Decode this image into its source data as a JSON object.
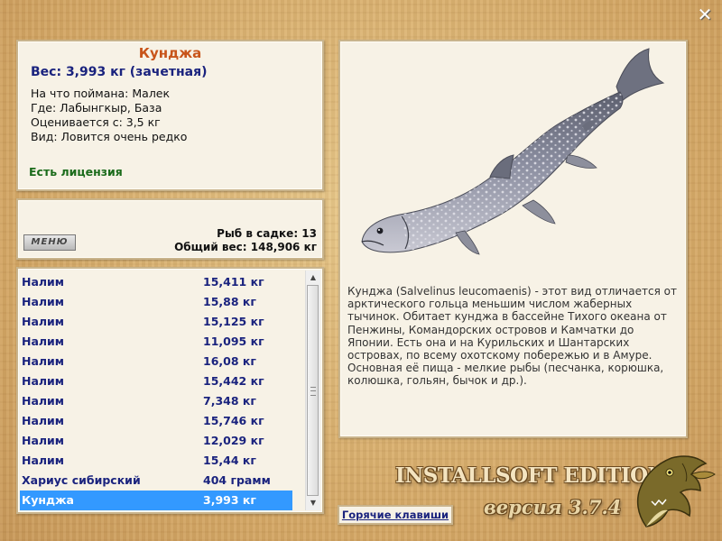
{
  "fish": {
    "title": "Кунджа",
    "weight": "Вес: 3,993 кг (зачетная)",
    "bait": "На что поймана: Малек",
    "location": "Где: Лабынгкыр, База",
    "valued": "Оценивается с: 3,5 кг",
    "type": "Вид: Ловится очень редко",
    "license": "Есть лицензия"
  },
  "cage": {
    "menu_label": "МЕНЮ",
    "count": "Рыб в садке: 13",
    "total_weight": "Общий вес: 148,906 кг"
  },
  "list": {
    "items": [
      {
        "name": "Налим",
        "weight": "15,411 кг"
      },
      {
        "name": "Налим",
        "weight": "15,88 кг"
      },
      {
        "name": "Налим",
        "weight": "15,125 кг"
      },
      {
        "name": "Налим",
        "weight": "11,095 кг"
      },
      {
        "name": "Налим",
        "weight": "16,08 кг"
      },
      {
        "name": "Налим",
        "weight": "15,442 кг"
      },
      {
        "name": "Налим",
        "weight": "7,348 кг"
      },
      {
        "name": "Налим",
        "weight": "15,746 кг"
      },
      {
        "name": "Налим",
        "weight": "12,029 кг"
      },
      {
        "name": "Налим",
        "weight": "15,44 кг"
      },
      {
        "name": "Хариус сибирский",
        "weight": "404 грамм"
      },
      {
        "name": "Кунджа",
        "weight": "3,993 кг"
      }
    ],
    "selected_index": 11
  },
  "description": "Кунджа (Salvelinus leucomaenis) - этот вид отличается от арктического гольца меньшим числом жаберных тычинок. Обитает кунджа в бассейне Тихого океана от Пенжины, Командорских островов и Камчатки до Японии. Есть она и на Курильских и Шантарских островах, по всему охотскому побережью и в Амуре. Основная её пища - мелкие рыбы (песчанка, корюшка, колюшка, гольян, бычок и др.).",
  "branding": {
    "edition": "INSTALLSOFT EDITION",
    "version": "версия 3.7.4"
  },
  "hotkeys_label": "Горячие клавиши",
  "colors": {
    "title": "#c8541a",
    "weight": "#1a237e",
    "license": "#1b6b1b",
    "selection": "#3399ff"
  },
  "icons": {
    "close": "close-icon"
  }
}
